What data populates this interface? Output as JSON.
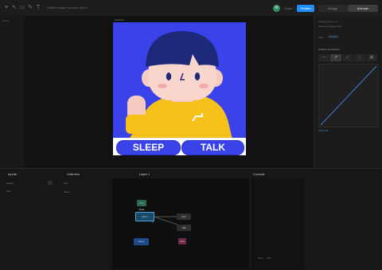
{
  "window": {
    "file_title": "Untitled state machine demo"
  },
  "header": {
    "avatar_initial": "M",
    "share_label": "Share",
    "publish_label": "Publish",
    "tabs": [
      {
        "label": "Design"
      },
      {
        "label": "Animate"
      }
    ]
  },
  "left_panel": {
    "label": "Layers"
  },
  "stage": {
    "artboard_label": "Artboard",
    "buttons": {
      "sleep": "SLEEP",
      "talk": "TALK"
    }
  },
  "right_panel": {
    "rows": [
      "Toggle_bones_sm",
      "Artboard_background"
    ],
    "timeline_label": "State",
    "timeline_value": "Default",
    "interpolation_title": "Default Interpolation",
    "interpolation_buttons": [
      "—",
      "↗",
      "↙",
      "⌇",
      "▦"
    ],
    "readout": "0.00  0.00"
  },
  "bottom": {
    "inputs": {
      "title": "Inputs",
      "rows": [
        "isSleep",
        "Talk"
      ]
    },
    "listeners": {
      "title": "Listeners",
      "rows": [
        "Talk",
        "Sleep"
      ]
    },
    "graph": {
      "title": "Layer 1",
      "nodes": [
        "Any State",
        "Entry",
        "Idle",
        "Talk",
        "Exit",
        "Sleep"
      ]
    },
    "console": {
      "title": "Console",
      "rows": [
        "Entry → Idle"
      ]
    }
  },
  "colors": {
    "accent": "#1d8fff",
    "brand_blue": "#3a42ea",
    "shirt_yellow": "#f6c21a"
  }
}
